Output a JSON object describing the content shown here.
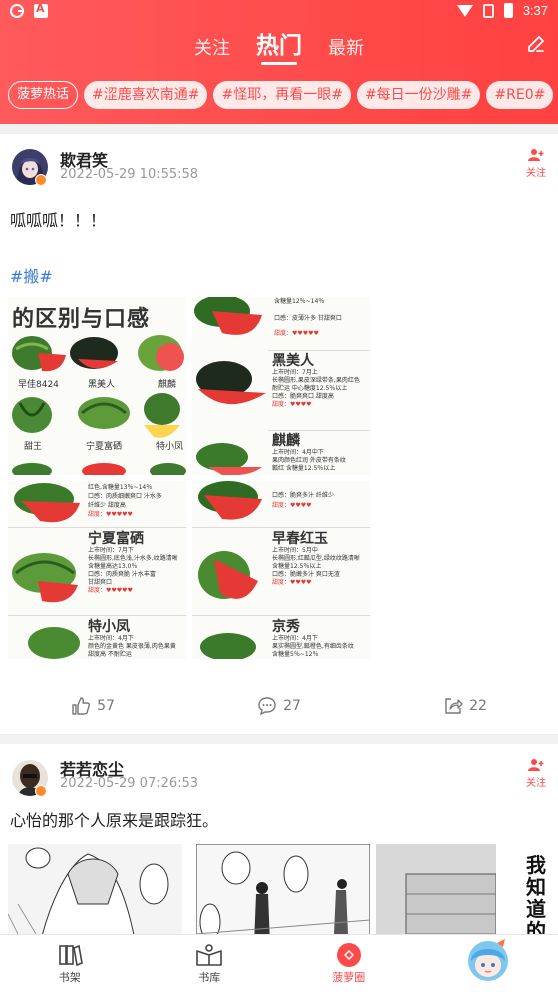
{
  "status_bar": {
    "time": "3:37"
  },
  "header": {
    "tabs": [
      {
        "label": "关注"
      },
      {
        "label": "热门"
      },
      {
        "label": "最新"
      }
    ],
    "edit_icon": "edit-icon",
    "accent_color": "#ff4a4a"
  },
  "hot_topics": {
    "label": "菠萝热话",
    "chips": [
      "#涩鹿喜欢南通#",
      "#怪耶，再看一眼#",
      "#每日一份沙雕#",
      "#RE0#"
    ]
  },
  "posts": [
    {
      "username": "欺君笑",
      "time": "2022-05-29 10:55:58",
      "follow_label": "关注",
      "text": "呱呱呱！！！",
      "tag": "#搬#",
      "images": {
        "title": "的区别与口感",
        "varieties_top": [
          "早佳8424",
          "黑美人",
          "麒麟",
          "甜王",
          "宁夏富硒",
          "特小凤"
        ],
        "rows_right_top": [
          {
            "name": "",
            "lines": [
              "含糖量12％~14％",
              "口感：皮薄汁多 甘甜爽口",
              "甜度：♥♥♥♥♥"
            ]
          },
          {
            "name": "黑美人",
            "lines": [
              "上市时间：7月上",
              "长椭圆形,果皮深绿带条,果肉红色",
              "耐贮运 中心糖度12.5％以上",
              "口感：脆爽爽口 甜度高",
              "甜度：♥♥♥♥"
            ]
          },
          {
            "name": "麒麟",
            "lines": [
              "上市时间：4月中下",
              "果肉颜色红润 外皮带有条纹",
              "瓤红 含糖量12.5％以上"
            ]
          }
        ],
        "rows_left_bottom": [
          {
            "name": "",
            "lines": [
              "红色,含糖量13％~14％",
              "口感：肉质细嫩爽口 汁水多",
              "纤维少 甜度高",
              "甜度：♥♥♥♥♥"
            ]
          },
          {
            "name": "宁夏富硒",
            "lines": [
              "上市时间：7月下",
              "长椭圆形,底色浅,汁水多,纹路清晰",
              "含糖量高达13.0％",
              "口感：肉质爽脆 汁水丰富",
              "甘甜爽口",
              "甜度：♥♥♥♥♥"
            ]
          },
          {
            "name": "特小凤",
            "lines": [
              "上市时间：4月下",
              "颜色的金黄色 果皮很薄,肉色果黄",
              "甜度高 不耐贮运"
            ]
          }
        ],
        "rows_right_bottom": [
          {
            "name": "",
            "lines": [
              "口感：脆爽多汁 纤维少",
              "甜度：♥♥♥♥"
            ]
          },
          {
            "name": "早春红玉",
            "lines": [
              "上市时间：5月中",
              "长椭圆形,红瓤瓜型,绿纹纹路清晰",
              "含糖量12.5％以上",
              "口感：脆嫩多汁 爽口无渣",
              "甜度：♥♥♥♥"
            ]
          },
          {
            "name": "京秀",
            "lines": [
              "上市时间：4月下",
              "果实椭圆型,瓤橙色,有细齿条纹",
              "含糖量5％~12％"
            ]
          }
        ]
      },
      "likes": "57",
      "comments": "27",
      "shares": "22"
    },
    {
      "username": "若若恋尘",
      "time": "2022-05-29 07:26:53",
      "follow_label": "关注",
      "text": "心怡的那个人原来是跟踪狂。",
      "manga_text": [
        "我知",
        "道的"
      ]
    }
  ],
  "bottom_nav": [
    {
      "label": "书架",
      "icon": "bookshelf-icon"
    },
    {
      "label": "书库",
      "icon": "library-icon"
    },
    {
      "label": "菠萝圈",
      "icon": "pineapple-circle-icon",
      "active": true
    },
    {
      "label": "",
      "icon": "profile-avatar-icon"
    }
  ]
}
